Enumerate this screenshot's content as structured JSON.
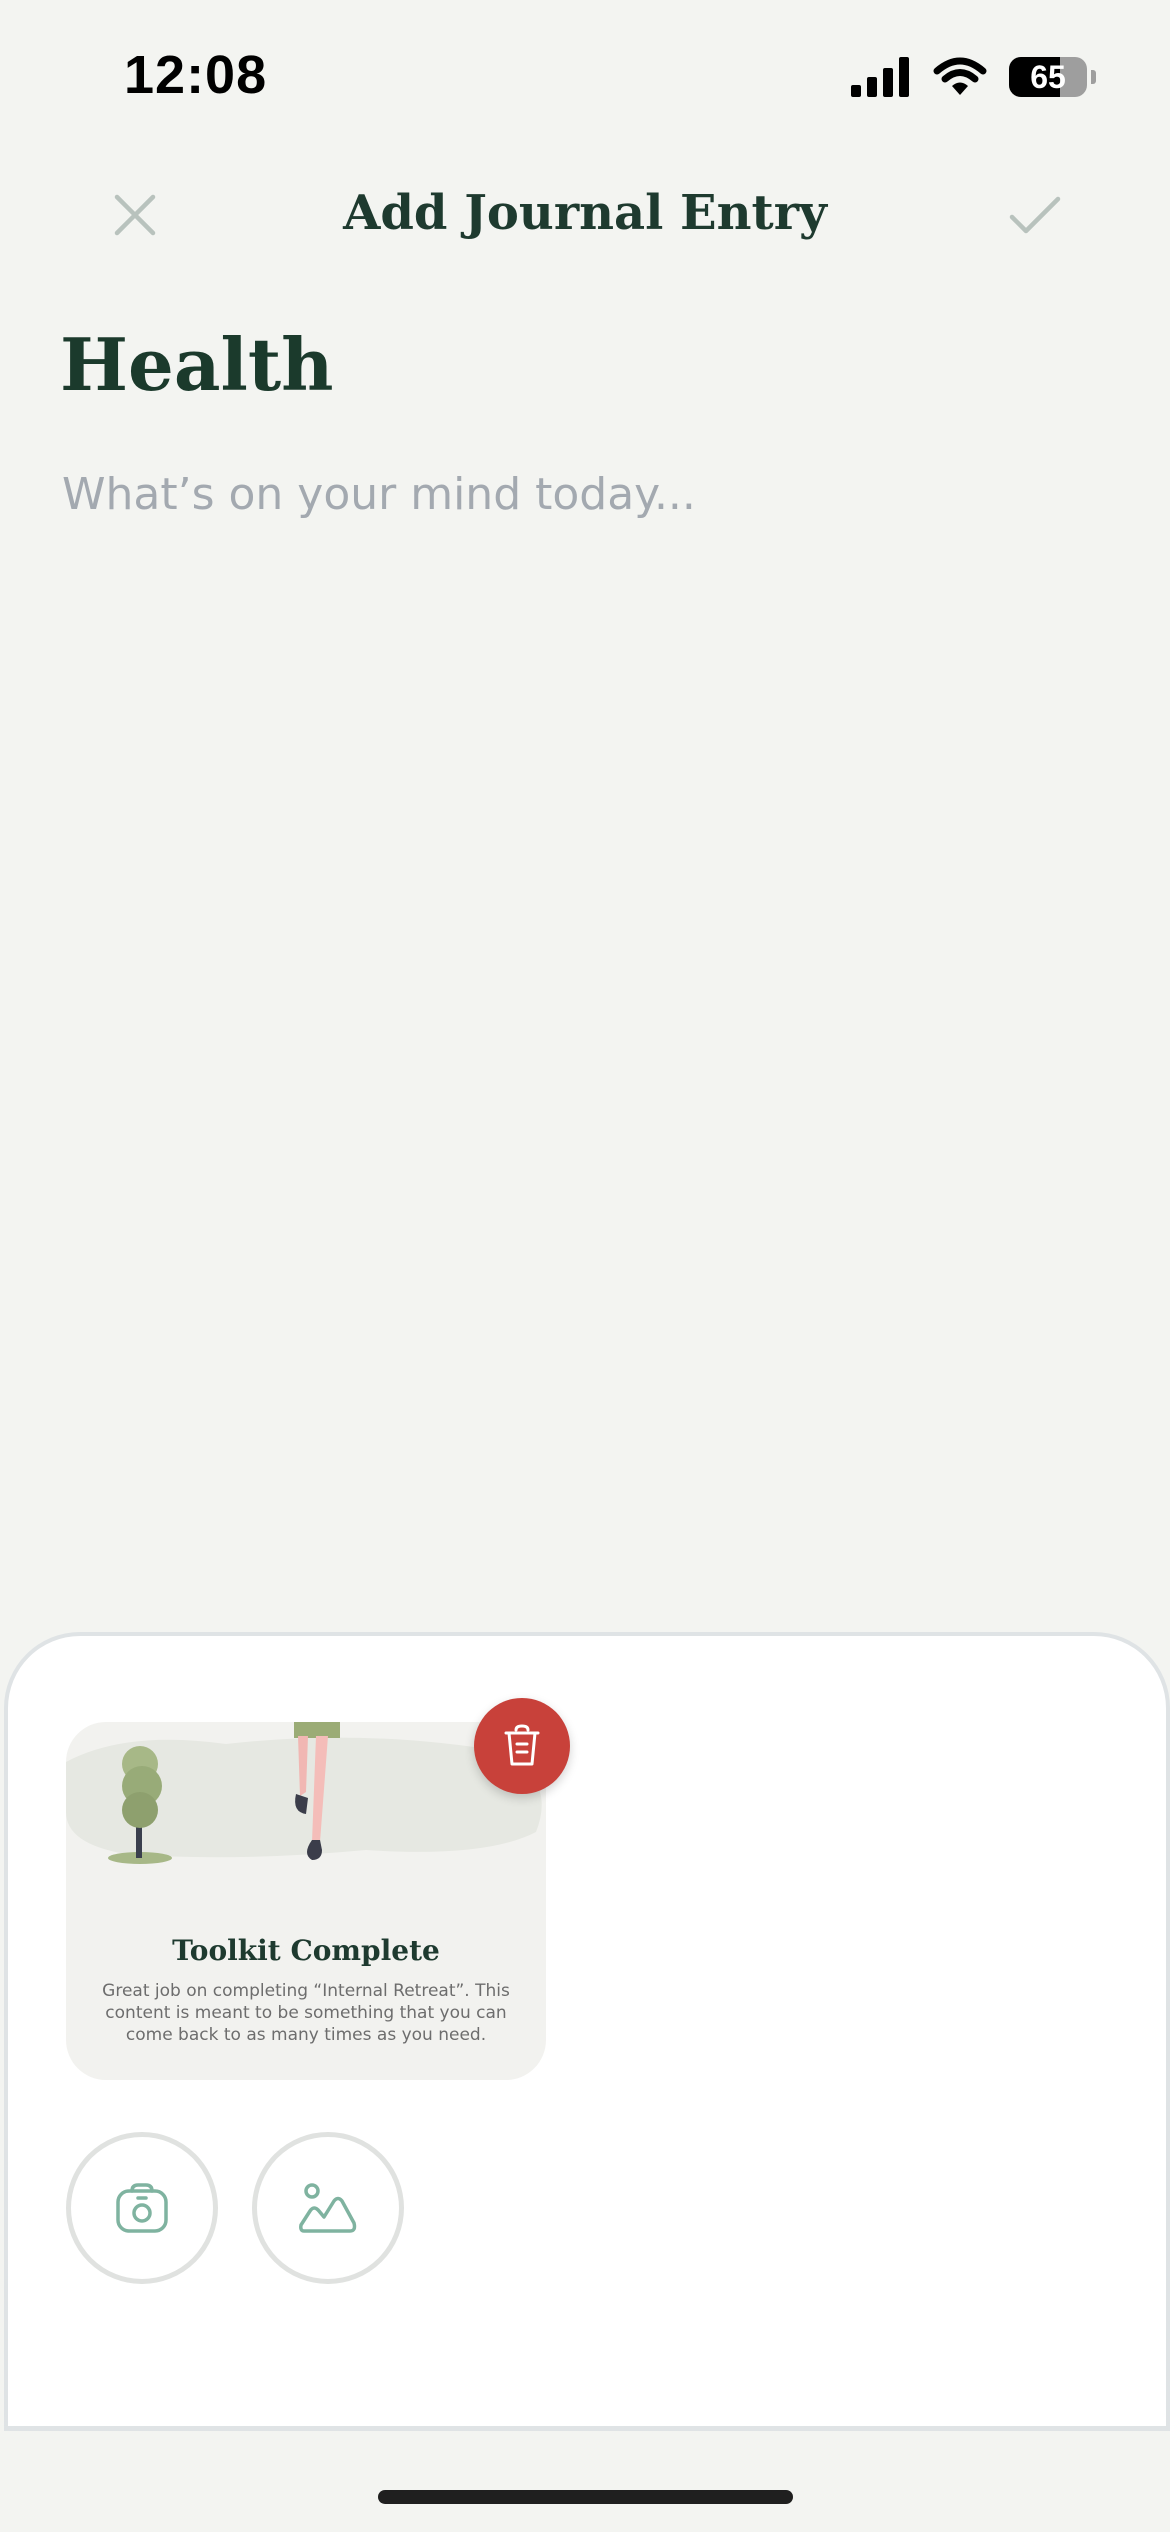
{
  "status_bar": {
    "time": "12:08",
    "battery_level": 65,
    "battery_text": "65"
  },
  "header": {
    "title": "Add Journal Entry",
    "close_icon": "close-icon",
    "confirm_icon": "checkmark-icon"
  },
  "entry": {
    "category": "Health",
    "placeholder": "What’s on your mind today...",
    "value": ""
  },
  "attachment": {
    "title": "Toolkit Complete",
    "body": "Great job on completing “Internal Retreat”.  This content is meant to be something that you can come back to as many times as you need.",
    "delete_icon": "trash-icon"
  },
  "media_buttons": [
    {
      "icon": "camera-icon"
    },
    {
      "icon": "image-icon"
    }
  ],
  "colors": {
    "background": "#f3f4f1",
    "title": "#1b3a2c",
    "delete": "#c8413a",
    "icon_accent": "#7fb3a0",
    "header_icon": "#b8c2bd"
  }
}
